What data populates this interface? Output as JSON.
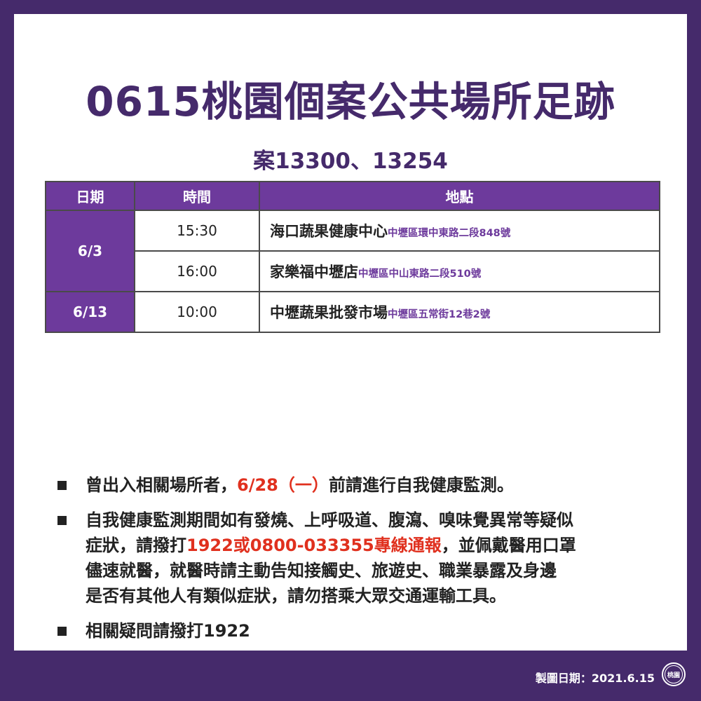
{
  "title": "0615桃園個案公共場所足跡",
  "subtitle": "案13300、13254",
  "table": {
    "headers": [
      "日期",
      "時間",
      "地點"
    ],
    "rows": [
      {
        "date": "6/3",
        "time": "15:30",
        "place": "海口蔬果健康中心",
        "address": "中壢區環中東路二段848號"
      },
      {
        "time": "16:00",
        "place": "家樂福中壢店",
        "address": "中壢區中山東路二段510號"
      },
      {
        "date": "6/13",
        "time": "10:00",
        "place": "中壢蔬果批發市場",
        "address": "中壢區五常街12巷2號"
      }
    ]
  },
  "notes": {
    "n1_a": "曾出入相關場所者，",
    "n1_red": "6/28（一）",
    "n1_b": "前請進行自我健康監測。",
    "n2_line1": "自我健康監測期間如有發燒、上呼吸道、腹瀉、嗅味覺異常等疑似",
    "n2_line2_a": "症狀，請撥打",
    "n2_line2_red": "1922或0800-033355專線通報",
    "n2_line2_b": "，並佩戴醫用口罩",
    "n2_line3": "儘速就醫，就醫時請主動告知接觸史、旅遊史、職業暴露及身邊",
    "n2_line4": "是否有其他人有類似症狀，請勿搭乘大眾交通運輸工具。",
    "n3": "相關疑問請撥打1922"
  },
  "footer": {
    "date_text": "製圖日期：2021.6.15",
    "seal_text": "桃園"
  },
  "colors": {
    "frame": "#452a6b",
    "header_fill": "#6d3a9c",
    "highlight": "#e0301e"
  }
}
